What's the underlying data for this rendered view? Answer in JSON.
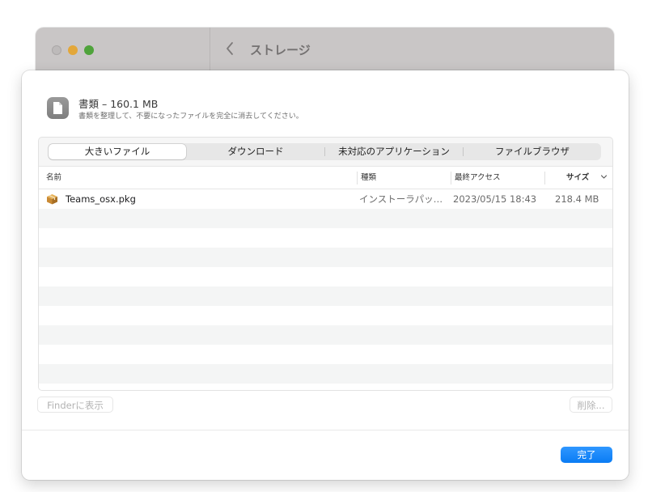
{
  "background_window": {
    "title": "ストレージ",
    "back_icon": "chevron-left-icon"
  },
  "header": {
    "icon": "document-icon",
    "title": "書類 – 160.1 MB",
    "description": "書類を整理して、不要になったファイルを完全に消去してください。"
  },
  "tabs": [
    {
      "label": "大きいファイル",
      "selected": true
    },
    {
      "label": "ダウンロード",
      "selected": false
    },
    {
      "label": "未対応のアプリケーション",
      "selected": false
    },
    {
      "label": "ファイルブラウザ",
      "selected": false
    }
  ],
  "table": {
    "columns": [
      "名前",
      "種類",
      "最終アクセス",
      "サイズ"
    ],
    "sort_column": "サイズ",
    "sort_icon": "chevron-down-icon",
    "rows": [
      {
        "icon": "package-icon",
        "name": "Teams_osx.pkg",
        "kind": "インストーラパッ…",
        "last_accessed": "2023/05/15 18:43",
        "size": "218.4 MB"
      }
    ]
  },
  "buttons": {
    "show_in_finder": "Finderに表示",
    "delete": "削除...",
    "done": "完了"
  },
  "colors": {
    "accent": "#0a7cf4",
    "traffic_red_inactive": "#bdbaba",
    "traffic_yellow": "#e3a73a",
    "traffic_green": "#4fa33b"
  }
}
